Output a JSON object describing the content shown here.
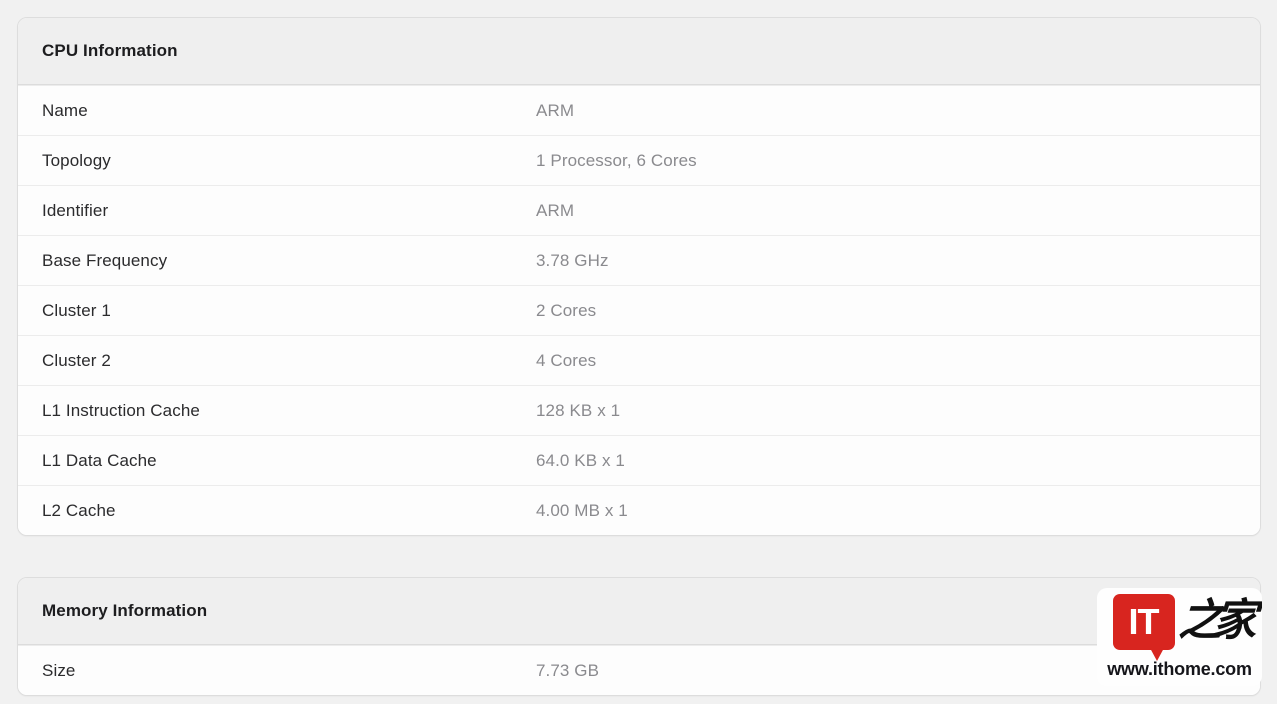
{
  "page": {
    "background_color": "#f1f1f1"
  },
  "cards": [
    {
      "title": "CPU Information",
      "rows": [
        {
          "label": "Name",
          "value": "ARM"
        },
        {
          "label": "Topology",
          "value": "1 Processor, 6 Cores"
        },
        {
          "label": "Identifier",
          "value": "ARM"
        },
        {
          "label": "Base Frequency",
          "value": "3.78 GHz"
        },
        {
          "label": "Cluster 1",
          "value": "2 Cores"
        },
        {
          "label": "Cluster 2",
          "value": "4 Cores"
        },
        {
          "label": "L1 Instruction Cache",
          "value": "128 KB x 1"
        },
        {
          "label": "L1 Data Cache",
          "value": "64.0 KB x 1"
        },
        {
          "label": "L2 Cache",
          "value": "4.00 MB x 1"
        }
      ]
    },
    {
      "title": "Memory Information",
      "rows": [
        {
          "label": "Size",
          "value": "7.73 GB"
        }
      ]
    }
  ],
  "watermark": {
    "logo_text": "IT",
    "logo_cn": "之家",
    "url": "www.ithome.com",
    "logo_color": "#d8251f"
  }
}
